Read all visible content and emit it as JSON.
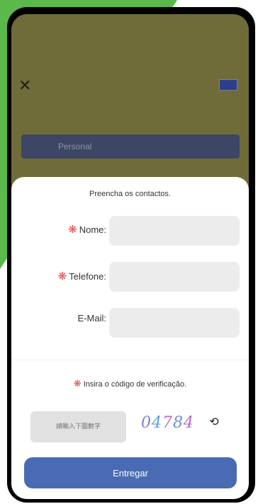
{
  "colors": {
    "accent_green": "#5bb84a",
    "required": "#e64a4a",
    "submit_bg": "#4a6bb3"
  },
  "header": {
    "close_icon": "close-icon",
    "language_icon": "flag-icon",
    "hint_text": "",
    "select_value": "Personal"
  },
  "sheet": {
    "title": "Preencha os contactos.",
    "fields": {
      "name_label": "Nome:",
      "phone_label": "Telefone:",
      "email_label": "E-Mail:"
    },
    "required_mark": "❋",
    "verify_label": "Insira o código de verificação.",
    "captcha_placeholder": "請輸入下圖數字",
    "captcha_code": "04784",
    "refresh_icon": "refresh-icon",
    "submit_label": "Entregar"
  }
}
